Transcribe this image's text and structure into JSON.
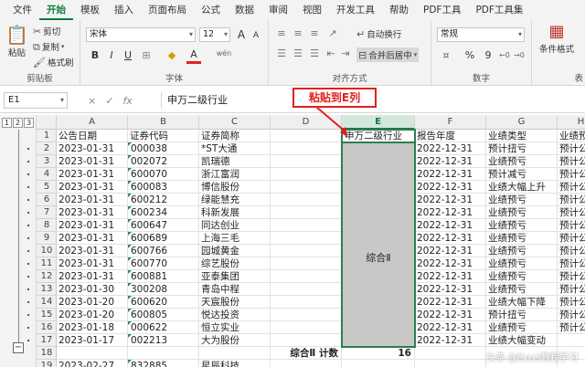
{
  "menu": {
    "tabs": [
      "文件",
      "开始",
      "模板",
      "插入",
      "页面布局",
      "公式",
      "数据",
      "审阅",
      "视图",
      "开发工具",
      "帮助",
      "PDF工具",
      "PDF工具集"
    ],
    "active_tab": "开始"
  },
  "ribbon": {
    "clipboard": {
      "paste": "粘贴",
      "cut": "剪切",
      "copy": "复制",
      "format_painter": "格式刷",
      "label": "剪贴板"
    },
    "font": {
      "font_name": "宋体",
      "font_size": "12",
      "bold": "B",
      "italic": "I",
      "underline": "U",
      "font_color_letter": "A",
      "wen": "wén",
      "label": "字体",
      "grow": "A",
      "shrink": "A"
    },
    "alignment": {
      "wrap_text": "自动换行",
      "merge_center": "合并后居中",
      "label": "对齐方式"
    },
    "number": {
      "format": "常规",
      "percent": "%",
      "comma": "9",
      "label": "数字"
    },
    "styles": {
      "conditional_format": "条件格式",
      "label": "表"
    }
  },
  "formula_bar": {
    "cell_ref": "E1",
    "cancel_icon": "×",
    "confirm_icon": "✓",
    "fx_icon": "fx",
    "value": "申万二级行业"
  },
  "annotation": {
    "callout_text": "粘贴到E列"
  },
  "outline": {
    "levels": [
      "1",
      "2",
      "3"
    ],
    "minus": "−"
  },
  "columns": [
    "A",
    "B",
    "C",
    "D",
    "E",
    "F",
    "G",
    "H"
  ],
  "rows": [
    "1",
    "2",
    "3",
    "4",
    "5",
    "6",
    "7",
    "8",
    "9",
    "10",
    "11",
    "12",
    "13",
    "14",
    "15",
    "16",
    "17",
    "18",
    "19"
  ],
  "sheet": {
    "header": [
      "公告日期",
      "证券代码",
      "证券简称",
      "",
      "申万二级行业",
      "报告年度",
      "业绩类型",
      "业绩预"
    ],
    "data": [
      [
        "2023-01-31",
        "000038",
        "*ST大通",
        "2022-12-31",
        "预计扭亏",
        "预计公"
      ],
      [
        "2023-01-31",
        "002072",
        "凯瑞德",
        "2022-12-31",
        "业绩预亏",
        "预计公"
      ],
      [
        "2023-01-31",
        "600070",
        "浙江富润",
        "2022-12-31",
        "预计减亏",
        "预计公"
      ],
      [
        "2023-01-31",
        "600083",
        "博信股份",
        "2022-12-31",
        "业绩大幅上升",
        "预计公"
      ],
      [
        "2023-01-31",
        "600212",
        "绿能慧充",
        "2022-12-31",
        "业绩预亏",
        "预计公"
      ],
      [
        "2023-01-31",
        "600234",
        "科新发展",
        "2022-12-31",
        "业绩预亏",
        "预计公"
      ],
      [
        "2023-01-31",
        "600647",
        "同达创业",
        "2022-12-31",
        "业绩预亏",
        "预计公"
      ],
      [
        "2023-01-31",
        "600689",
        "上海三毛",
        "2022-12-31",
        "业绩预亏",
        "预计公"
      ],
      [
        "2023-01-31",
        "600766",
        "园城黄金",
        "2022-12-31",
        "业绩预亏",
        "预计公"
      ],
      [
        "2023-01-31",
        "600770",
        "综艺股份",
        "2022-12-31",
        "业绩预亏",
        "预计公"
      ],
      [
        "2023-01-31",
        "600881",
        "亚泰集团",
        "2022-12-31",
        "业绩预亏",
        "预计公"
      ],
      [
        "2023-01-30",
        "300208",
        "青岛中程",
        "2022-12-31",
        "业绩预亏",
        "预计公"
      ],
      [
        "2023-01-20",
        "600620",
        "天宸股份",
        "2022-12-31",
        "业绩大幅下降",
        "预计公"
      ],
      [
        "2023-01-20",
        "600805",
        "悦达投资",
        "2022-12-31",
        "预计扭亏",
        "预计公"
      ],
      [
        "2023-01-18",
        "000622",
        "恒立实业",
        "2022-12-31",
        "业绩预亏",
        "预计公"
      ],
      [
        "2023-01-17",
        "002213",
        "大为股份",
        "2022-12-31",
        "业绩大幅变动",
        ""
      ]
    ],
    "merged_value": "综合Ⅱ",
    "subtotal_label": "综合Ⅱ 计数",
    "subtotal_count": "16",
    "row19": [
      "2023-02-27",
      "832885",
      "星辰科技"
    ]
  },
  "watermark": "头条 @Excel教程学习",
  "colors": {
    "accent": "#107c41",
    "annotation": "#e02020",
    "merged_fill": "#c8c8c8"
  }
}
